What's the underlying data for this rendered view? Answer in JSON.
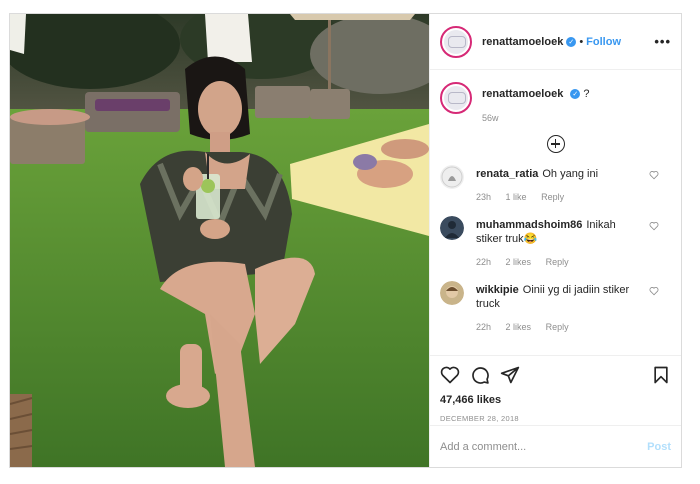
{
  "header": {
    "username": "renattamoeloek",
    "separator": "•",
    "follow_label": "Follow",
    "more_label": "•••"
  },
  "caption": {
    "username": "renattamoeloek",
    "text": "?",
    "time": "56w"
  },
  "comments": [
    {
      "username": "renata_ratia",
      "text": "Oh yang ini",
      "time": "23h",
      "likes": "1 like",
      "reply": "Reply"
    },
    {
      "username": "muhammadshoim86",
      "text": "Inikah stiker truk😂",
      "time": "22h",
      "likes": "2 likes",
      "reply": "Reply"
    },
    {
      "username": "wikkipie",
      "text": "Oinii yg di jadiin stiker truck",
      "time": "22h",
      "likes": "2 likes",
      "reply": "Reply"
    }
  ],
  "likes": "47,466 likes",
  "date": "DECEMBER 28, 2018",
  "add_comment": {
    "placeholder": "Add a comment...",
    "post_label": "Post"
  },
  "colors": {
    "link_blue": "#3897f0",
    "post_disabled": "#b2dffc",
    "muted": "#8e8e8e",
    "ring": "#d62976"
  }
}
